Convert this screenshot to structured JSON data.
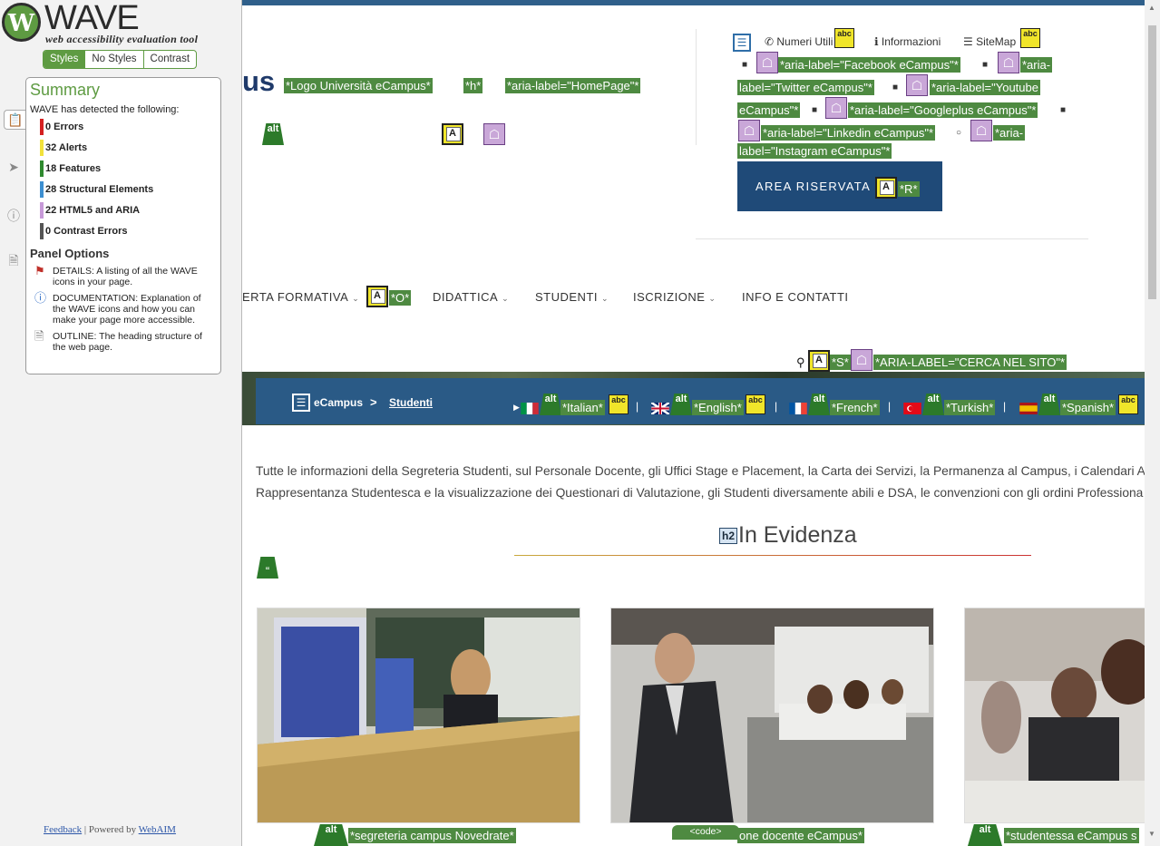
{
  "wave": {
    "logo_letter": "W",
    "title": "WAVE",
    "subtitle": "web accessibility evaluation tool",
    "view_tabs": [
      {
        "label": "Styles",
        "selected": true
      },
      {
        "label": "No Styles",
        "selected": false
      },
      {
        "label": "Contrast",
        "selected": false
      }
    ],
    "summary_title": "Summary",
    "summary_desc": "WAVE has detected the following:",
    "stats": [
      {
        "label": "0 Errors",
        "color": "#d42020"
      },
      {
        "label": "32 Alerts",
        "color": "#f2e23b"
      },
      {
        "label": "18 Features",
        "color": "#2f8a2f"
      },
      {
        "label": "28 Structural Elements",
        "color": "#3d8fd1"
      },
      {
        "label": "22 HTML5 and ARIA",
        "color": "#c79ad8"
      },
      {
        "label": "0 Contrast Errors",
        "color": "#555555"
      }
    ],
    "panel_options_title": "Panel Options",
    "options": [
      {
        "icon": "flag-icon",
        "text": "DETAILS: A listing of all the WAVE icons in your page."
      },
      {
        "icon": "info-icon",
        "text": "DOCUMENTATION: Explanation of the WAVE icons and how you can make your page more accessible."
      },
      {
        "icon": "document-icon",
        "text": "OUTLINE: The heading structure of the web page."
      }
    ],
    "footer_feedback": "Feedback",
    "footer_sep": "|",
    "footer_powered": "Powered by",
    "footer_webaim": "WebAIM"
  },
  "page": {
    "logo_tail": "us",
    "logo_labels": [
      "*Logo Università eCampus*",
      "*h*",
      "*aria-label=\"HomePage\"*"
    ],
    "icon_labels": {
      "alt": "alt",
      "abc": "abc",
      "a_letter": "A"
    },
    "top_links": [
      "Numeri Utili",
      "Informazioni",
      "SiteMap"
    ],
    "social_labels": [
      "*aria-label=\"Facebook eCampus\"*",
      "*aria-",
      "label=\"Twitter eCampus\"*",
      "*aria-label=\"Youtube",
      "eCampus\"*",
      "*aria-label=\"Googleplus eCampus\"*",
      "*aria-label=\"Linkedin eCampus\"*",
      "*aria-",
      "label=\"Instagram eCampus\"*"
    ],
    "reserved_area": "AREA RISERVATA",
    "reserved_label": "*R*",
    "nav_items": [
      "ERTA FORMATIVA",
      "DIDATTICA",
      "STUDENTI",
      "ISCRIZIONE",
      "INFO E CONTATTI"
    ],
    "nav_label": "*O*",
    "search_labels": [
      "*S*",
      "*ARIA-LABEL=\"CERCA NEL SITO\"*"
    ],
    "breadcrumb": {
      "home": "eCampus",
      "separator": ">",
      "current": "Studenti"
    },
    "languages": [
      {
        "label": "*Italian*",
        "colors": [
          "#009246",
          "#ffffff",
          "#ce2b37"
        ]
      },
      {
        "label": "*English*",
        "colors": [
          "#012169",
          "#ffffff",
          "#c8102e"
        ]
      },
      {
        "label": "*French*",
        "colors": [
          "#0055a4",
          "#ffffff",
          "#ef4135"
        ]
      },
      {
        "label": "*Turkish*",
        "colors": [
          "#e30a17",
          "#ffffff",
          "#e30a17"
        ]
      },
      {
        "label": "*Spanish*",
        "colors": [
          "#aa151b",
          "#f1bf00",
          "#aa151b"
        ]
      }
    ],
    "lang_sep": "|",
    "intro_lines": [
      "Tutte le informazioni della Segreteria Studenti, sul Personale Docente, gli Uffici Stage e Placement, la Carta dei Servizi, la Permanenza al Campus, i Calendari A",
      "Rappresentanza Studentesca e la visualizzazione dei Questionari di Valutazione, gli Studenti diversamente abili e DSA, le convenzioni con gli ordini Professiona"
    ],
    "h2_tag": "h2",
    "heading": "In Evidenza",
    "cards": [
      {
        "alt": "*segreteria campus Novedrate*"
      },
      {
        "alt": "one docente eCampus*"
      },
      {
        "alt": "*studentessa eCampus s"
      }
    ],
    "code_label": "<code>"
  }
}
